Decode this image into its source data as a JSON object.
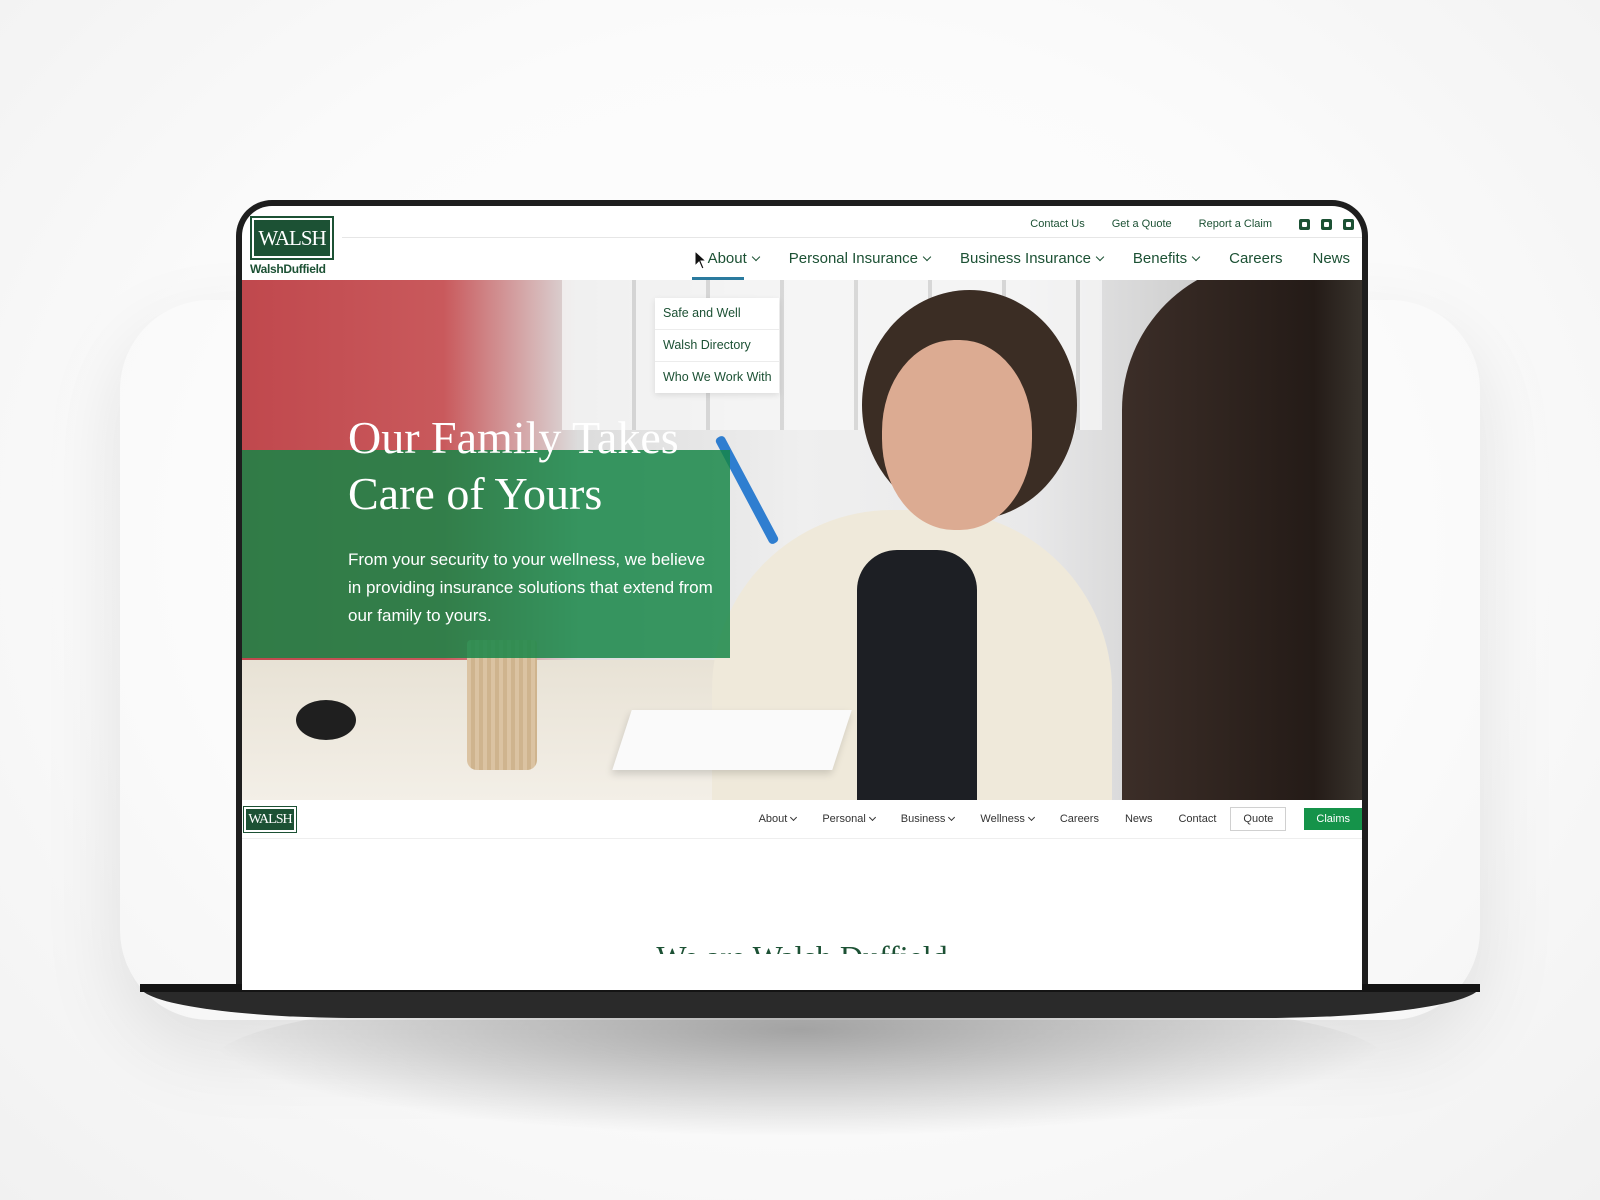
{
  "site": {
    "logo_text": "WALSH",
    "logo_subtext": "WalshDuffield"
  },
  "utility_nav": {
    "items": [
      "Contact Us",
      "Get a Quote",
      "Report a Claim"
    ],
    "social_icons": [
      "facebook-icon",
      "linkedin-icon",
      "twitter-icon"
    ]
  },
  "main_nav": {
    "items": [
      {
        "label": "About",
        "has_dropdown": true,
        "active": true
      },
      {
        "label": "Personal Insurance",
        "has_dropdown": true
      },
      {
        "label": "Business Insurance",
        "has_dropdown": true
      },
      {
        "label": "Benefits",
        "has_dropdown": true
      },
      {
        "label": "Careers",
        "has_dropdown": false
      },
      {
        "label": "News",
        "has_dropdown": false
      }
    ]
  },
  "about_dropdown": {
    "items": [
      "Safe and Well",
      "Walsh Directory",
      "Who We Work With"
    ]
  },
  "hero": {
    "title": "Our Family Takes Care of Yours",
    "text": "From your security to your wellness, we believe in providing insurance solutions that extend from our family to yours."
  },
  "sticky_nav": {
    "logo_text": "WALSH",
    "items": [
      {
        "label": "About",
        "has_dropdown": true
      },
      {
        "label": "Personal",
        "has_dropdown": true
      },
      {
        "label": "Business",
        "has_dropdown": true
      },
      {
        "label": "Wellness",
        "has_dropdown": true
      },
      {
        "label": "Careers",
        "has_dropdown": false
      },
      {
        "label": "News",
        "has_dropdown": false
      },
      {
        "label": "Contact",
        "has_dropdown": false
      }
    ],
    "quote_label": "Quote",
    "claims_label": "Claims"
  },
  "below_fold_title": "We are Walsh Duffield",
  "colors": {
    "brand_green": "#1c5134",
    "accent_green": "#15934a",
    "active_underline": "#2a7a9e"
  }
}
